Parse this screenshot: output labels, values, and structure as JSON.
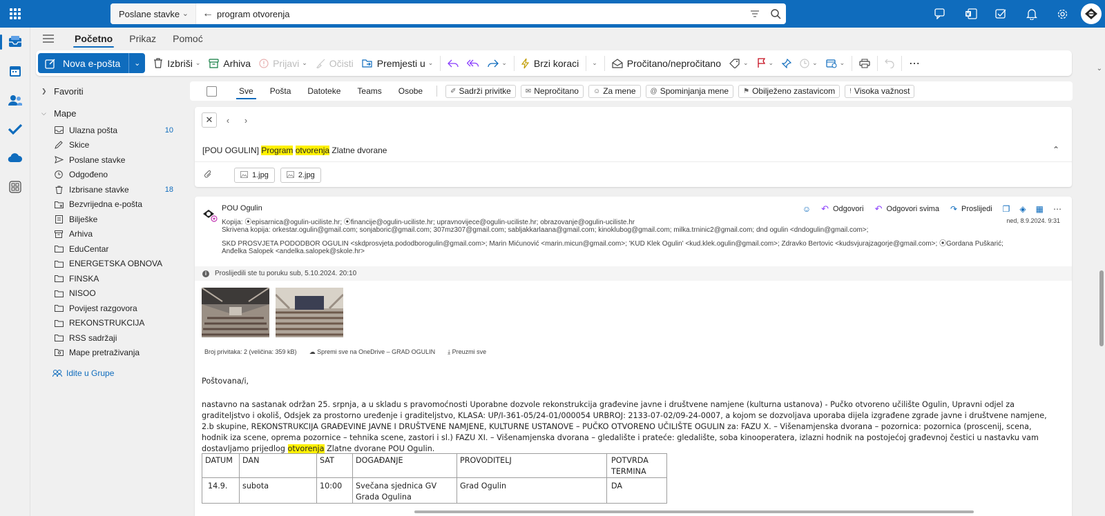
{
  "colors": {
    "brand": "#0f6cbd",
    "highlight": "#fff100",
    "link": "#0f6cbd"
  },
  "topbar": {
    "scope": "Poslane stavke",
    "query": "program otvorenja",
    "icons": [
      "app-launcher-icon",
      "teams-chat-icon",
      "word-icon",
      "todo-icon",
      "bell-icon",
      "settings-icon",
      "avatar"
    ]
  },
  "ribbon": {
    "tabs": [
      "Početno",
      "Prikaz",
      "Pomoć"
    ],
    "new_mail": "Nova e-pošta",
    "delete": "Izbriši",
    "archive": "Arhiva",
    "report": "Prijavi",
    "sweep": "Očisti",
    "move": "Premjesti u",
    "quick_steps": "Brzi koraci",
    "read_unread": "Pročitano/nepročitano"
  },
  "folders": {
    "favorites": "Favoriti",
    "folders_label": "Mape",
    "items": [
      {
        "label": "Ulazna pošta",
        "count": "10"
      },
      {
        "label": "Skice",
        "count": ""
      },
      {
        "label": "Poslane stavke",
        "count": ""
      },
      {
        "label": "Odgođeno",
        "count": ""
      },
      {
        "label": "Izbrisane stavke",
        "count": "18"
      },
      {
        "label": "Bezvrijedna e-pošta",
        "count": ""
      },
      {
        "label": "Bilješke",
        "count": ""
      },
      {
        "label": "Arhiva",
        "count": ""
      },
      {
        "label": "EduCentar",
        "count": ""
      },
      {
        "label": "ENERGETSKA OBNOVA",
        "count": ""
      },
      {
        "label": "FINSKA",
        "count": ""
      },
      {
        "label": "NISOO",
        "count": ""
      },
      {
        "label": "Povijest razgovora",
        "count": ""
      },
      {
        "label": "REKONSTRUKCIJA",
        "count": ""
      },
      {
        "label": "RSS sadržaji",
        "count": ""
      },
      {
        "label": "Mape pretraživanja",
        "count": ""
      }
    ],
    "goto_groups": "Idite u Grupe"
  },
  "filters": {
    "tabs": [
      "Sve",
      "Pošta",
      "Datoteke",
      "Teams",
      "Osobe"
    ],
    "pills": [
      "Sadrži privitke",
      "Nepročitano",
      "Za mene",
      "Spominjanja mene",
      "Obilježeno zastavicom",
      "Visoka važnost"
    ]
  },
  "thread": {
    "subject_pre": "[POU OGULIN] ",
    "subject_hl1": "Program",
    "subject_hl2": "otvorenja",
    "subject_post": " Zlatne dvorane",
    "attachments": [
      "1.jpg",
      "2.jpg"
    ]
  },
  "message": {
    "sender": "POU Ogulin",
    "cc_line": "Kopija: ⦿episarnica@ogulin-uciliste.hr;  ⦿financije@ogulin-uciliste.hr;  upravnovijece@ogulin-uciliste.hr;  obrazovanje@ogulin-uciliste.hr",
    "bcc_line1": "Skrivena kopija: orkestar.ogulin@gmail.com;  sonjaboric@gmail.com;  307mz307@gmail.com;  sabljakkarlaana@gmail.com;  kinoklubog@gmail.com;  milka.trninic2@gmail.com;  dnd ogulin <dndogulin@gmail.com>;",
    "bcc_line2": " SKD PROSVJETA PODODBOR OGULIN <skdprosvjeta.pododborogulin@gmail.com>;  Marin Mićunović <marin.micun@gmail.com>;  'KUD Klek Ogulin' <kud.klek.ogulin@gmail.com>;  Zdravko Bertovic <kudsvjurajzagorje@gmail.com>;  ⦿Gordana Puškarić;",
    "bcc_line3": " Anđelka Salopek <andelka.salopek@skole.hr>",
    "reply": "Odgovori",
    "reply_all": "Odgovori svima",
    "forward": "Proslijedi",
    "date": "ned, 8.9.2024. 9:31",
    "forwarded_note": "Proslijedili ste tu poruku sub, 5.10.2024. 20:10",
    "att_count": "Broj privitaka: 2 (veličina: 359 kB)",
    "save_onedrive": "Spremi sve na OneDrive – GRAD OGULIN",
    "download_all": "Preuzmi sve",
    "greeting": "Poštovana/i,",
    "body_main": "nastavno na sastanak održan 25. srpnja, a u skladu s pravomoćnosti Uporabne dozvole rekonstrukcija građevine javne i društvene namjene (kulturna ustanova) - Pučko otvoreno učilište Ogulin, Upravni odjel za graditeljstvo i okoliš, Odsjek za prostorno uređenje i graditeljstvo, KLASA: UP/I-361-05/24-01/000054 URBROJ: 2133-07-02/09-24-0007, a kojom se dozvoljava uporaba dijela izgrađene zgrade javne i društvene namjene, 2.b skupine, REKONSTRUKCIJA GRAĐEVINE JAVNE I DRUŠTVENE NAMJENE, KULTURNE USTANOVE – PUČKO OTVORENO UČILIŠTE OGULIN za: FAZU X. – Višenamjenska dvorana – pozornica: pozornica (proscenij, scena, hodnik iza scene, oprema pozornice – tehnika scene, zastori i sl.) FAZU XI. – Višenamjenska dvorana – gledalište i prateće: gledalište, soba kinooperatera, izlazni hodnik na postojećoj građevnoj čestici u nastavku vam dostavljamo prijedlog ",
    "body_hl": "otvorenja",
    "body_end": " Zlatne dvorane POU Ogulin."
  },
  "table": {
    "headers": [
      "DATUM",
      "DAN",
      "SAT",
      "DOGAĐANJE",
      "PROVODITELJ",
      "POTVRDA TERMINA"
    ],
    "rows": [
      [
        "14.9.",
        "subota",
        "10:00",
        "Svečana sjednica GV Grada Ogulina",
        "Grad Ogulin",
        "DA"
      ]
    ]
  }
}
